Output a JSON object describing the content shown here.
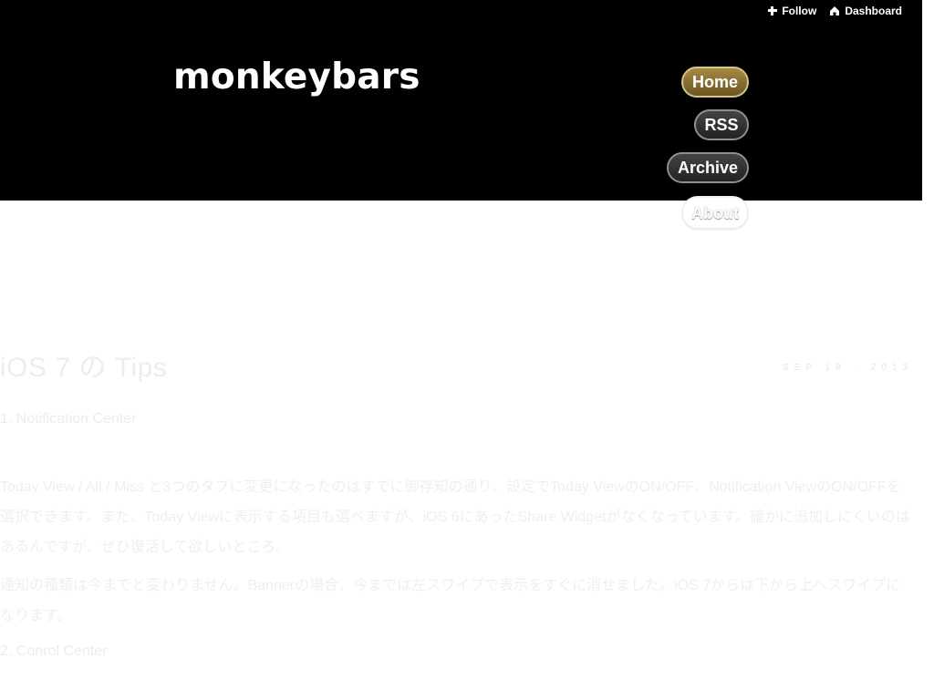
{
  "topbar": {
    "follow_label": "Follow",
    "dashboard_label": "Dashboard"
  },
  "header": {
    "site_title": "monkeybars"
  },
  "nav": {
    "home": "Home",
    "rss": "RSS",
    "archive": "Archive",
    "about": "About"
  },
  "post": {
    "title": "iOS 7 の Tips",
    "meta": "SEP 18 · 2013",
    "section_1_heading": "1. Notification Center",
    "paragraph_1": "Today View / All / Miss と3つのタブに変更になったのはすでに御存知の通り。設定でToday ViewのON/OFF、Notification ViewのON/OFFを選択できます。また、Today Viewに表示する項目も選べますが、iOS 6にあったShare Widgetがなくなっています。確かに追加しにくいのはあるんですが、ぜひ復活して欲しいところ。",
    "paragraph_2": "通知の種類は今までと変わりません。Bannerの場合、今までは左スワイプで表示をすぐに消せました。iOS 7からは下から上へスワイプになります。",
    "section_2_heading": "2. Conrol Center"
  },
  "colors": {
    "header_background": "#000000",
    "home_button": "#8f7435",
    "body_background": "#ffffff"
  },
  "icons": {
    "follow": "plus-icon",
    "dashboard": "home-icon"
  }
}
